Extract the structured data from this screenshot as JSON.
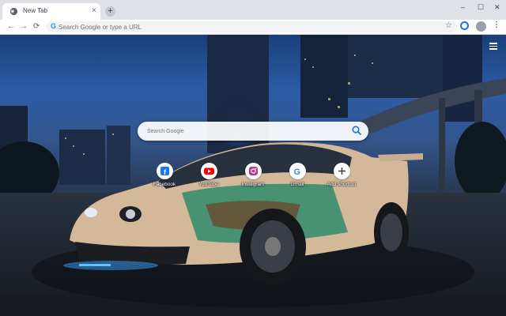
{
  "tab": {
    "title": "New Tab",
    "close": "×",
    "new_tab": "+"
  },
  "window_controls": {
    "minimize": "–",
    "maximize": "☐",
    "close": "✕"
  },
  "toolbar": {
    "back": "←",
    "forward": "→",
    "reload": "⟳",
    "omnibox_placeholder": "Search Google or type a URL",
    "star": "☆",
    "menu": "⋮"
  },
  "ntp": {
    "search_placeholder": "Search Google",
    "shortcuts": [
      {
        "label": "Facebook",
        "icon": "facebook-icon",
        "color": "#1877f2"
      },
      {
        "label": "YouTube",
        "icon": "youtube-icon",
        "color": "#ff0000"
      },
      {
        "label": "Instagram",
        "icon": "instagram-icon",
        "color": "#c13584"
      },
      {
        "label": "Gmail",
        "icon": "google-icon",
        "color": "#4285f4"
      },
      {
        "label": "Add shortcut",
        "icon": "plus-icon",
        "color": "#3c4043"
      }
    ]
  }
}
